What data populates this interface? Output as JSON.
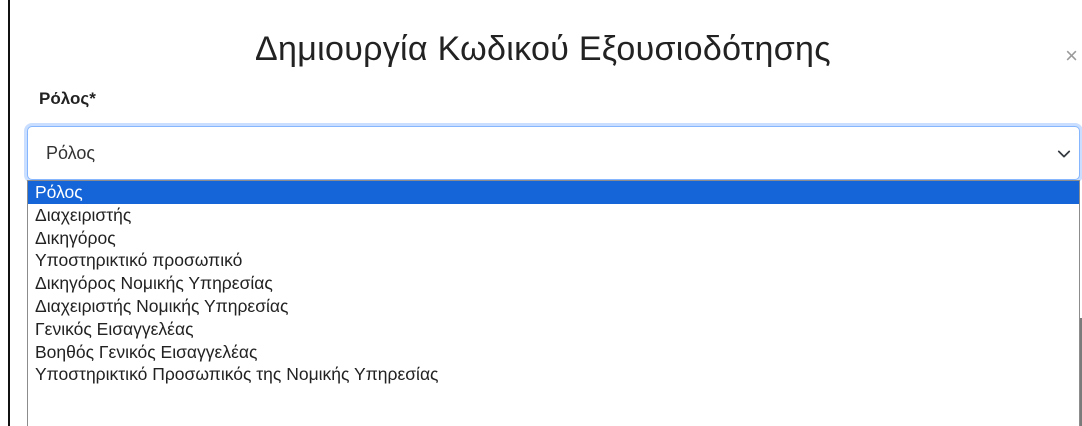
{
  "modal": {
    "title": "Δημιουργία Κωδικού Εξουσιοδότησης",
    "close_icon": "×"
  },
  "field": {
    "label": "Ρόλος*",
    "selected_value": "Ρόλος"
  },
  "dropdown": {
    "options": [
      "Ρόλος",
      "Διαχειριστής",
      "Δικηγόρος",
      "Υποστηρικτικό προσωπικό",
      "Δικηγόρος Νομικής Υπηρεσίας",
      "Διαχειριστής Νομικής Υπηρεσίας",
      "Γενικός Εισαγγελέας",
      "Βοηθός Γενικός Εισαγγελέας",
      "Υποστηρικτικό Προσωπικός της Νομικής Υπηρεσίας"
    ],
    "highlighted_index": 0
  },
  "colors": {
    "highlight": "#1565d8",
    "focus_border": "#86b7fe",
    "backdrop": "#7b7b7b"
  }
}
